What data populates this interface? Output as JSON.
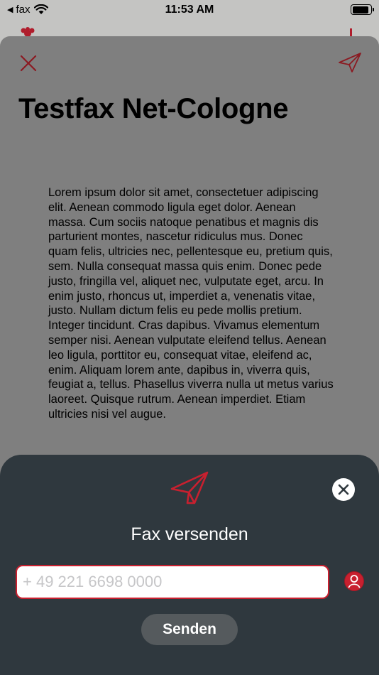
{
  "status_bar": {
    "back_app": "fax",
    "time": "11:53 AM",
    "battery_level": 0.9
  },
  "document": {
    "title": "Testfax Net-Cologne",
    "body": "Lorem ipsum dolor sit amet, consectetuer adipiscing elit. Aenean commodo ligula eget dolor. Aenean massa. Cum sociis natoque penatibus et magnis dis parturient montes, nascetur ridiculus mus. Donec quam felis, ultricies nec, pellentesque eu, pretium quis, sem. Nulla consequat massa quis enim. Donec pede justo, fringilla vel, aliquet nec, vulputate eget, arcu. In enim justo, rhoncus ut, imperdiet a, venenatis vitae, justo. Nullam dictum felis eu pede mollis pretium. Integer tincidunt. Cras dapibus. Vivamus elementum semper nisi. Aenean vulputate eleifend tellus. Aenean leo ligula, porttitor eu, consequat vitae, eleifend ac, enim. Aliquam lorem ante, dapibus in, viverra quis, feugiat a, tellus. Phasellus viverra nulla ut metus varius laoreet. Quisque rutrum. Aenean imperdiet. Etiam ultricies nisi vel augue."
  },
  "send_sheet": {
    "title": "Fax versenden",
    "fax_number_value": "",
    "fax_number_placeholder": "+ 49 221 6698 0000",
    "send_button_label": "Senden"
  },
  "icons": {
    "close": "close-icon",
    "send": "paper-plane-icon",
    "dismiss": "close-circle-icon",
    "contacts": "contact-person-icon"
  },
  "colors": {
    "accent_red": "#c8202f",
    "sheet_background": "#2f383e",
    "dimmed_overlay": "#7f7f7f",
    "send_button": "#555a5d"
  }
}
